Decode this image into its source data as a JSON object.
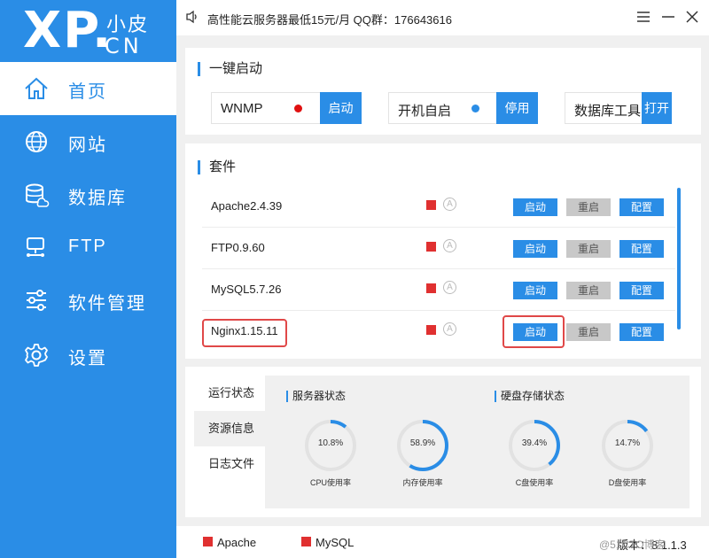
{
  "logo": {
    "main": "XP.",
    "sub_top": "小皮",
    "sub_bottom": "CN"
  },
  "nav": [
    {
      "label": "首页",
      "icon": "home-icon"
    },
    {
      "label": "网站",
      "icon": "globe-icon"
    },
    {
      "label": "数据库",
      "icon": "database-icon"
    },
    {
      "label": "FTP",
      "icon": "ftp-icon"
    },
    {
      "label": "软件管理",
      "icon": "sliders-icon"
    },
    {
      "label": "设置",
      "icon": "gear-icon"
    }
  ],
  "header": {
    "notice": "高性能云服务器最低15元/月  QQ群：176643616"
  },
  "quick": {
    "title": "一键启动",
    "items": [
      {
        "label": "WNMP",
        "button": "启动",
        "dot_color": "#e01010"
      },
      {
        "label": "开机自启",
        "button": "停用",
        "dot_color": "#2a8de6"
      },
      {
        "label": "数据库工具",
        "button": "打开"
      }
    ]
  },
  "suite": {
    "title": "套件",
    "rows": [
      {
        "name": "Apache2.4.39",
        "auto": "A",
        "start": "启动",
        "restart": "重启",
        "config": "配置"
      },
      {
        "name": "FTP0.9.60",
        "auto": "A",
        "start": "启动",
        "restart": "重启",
        "config": "配置"
      },
      {
        "name": "MySQL5.7.26",
        "auto": "A",
        "start": "启动",
        "restart": "重启",
        "config": "配置"
      },
      {
        "name": "Nginx1.15.11",
        "auto": "A",
        "start": "启动",
        "restart": "重启",
        "config": "配置"
      }
    ]
  },
  "tabs": [
    "运行状态",
    "资源信息",
    "日志文件"
  ],
  "status": {
    "server_title": "服务器状态",
    "disk_title": "硬盘存储状态",
    "gauges": [
      {
        "value": "10.8%",
        "percent": 10.8,
        "label": "CPU使用率"
      },
      {
        "value": "58.9%",
        "percent": 58.9,
        "label": "内存使用率"
      },
      {
        "value": "39.4%",
        "percent": 39.4,
        "label": "C盘使用率"
      },
      {
        "value": "14.7%",
        "percent": 14.7,
        "label": "D盘使用率"
      }
    ]
  },
  "footer": {
    "apache": "Apache",
    "mysql": "MySQL",
    "version": "版本：8.1.1.3",
    "watermark": "@51CTO博客"
  },
  "colors": {
    "accent": "#2a8de6",
    "status_stopped": "#e03030",
    "highlight": "#e04848"
  }
}
